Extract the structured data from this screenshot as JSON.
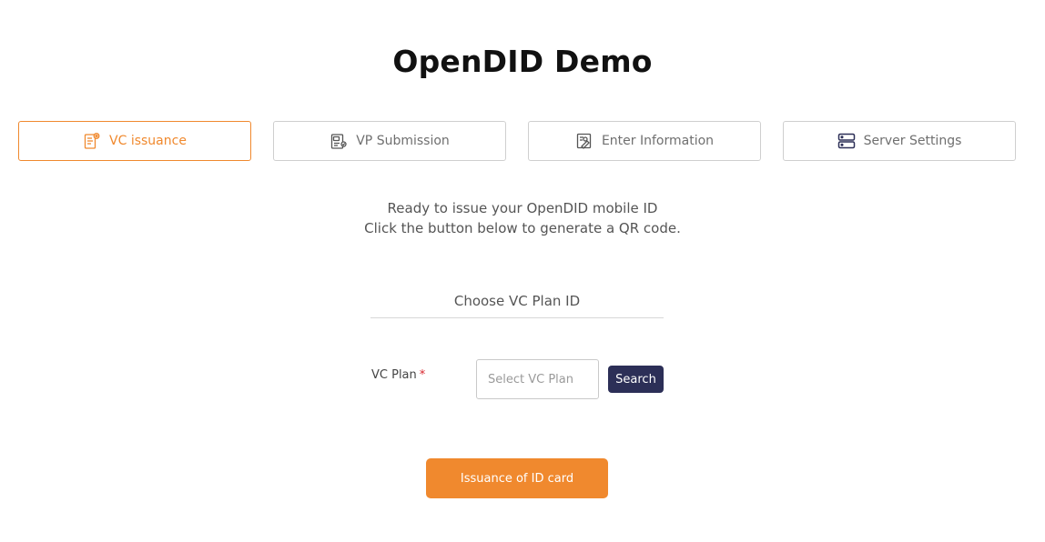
{
  "header": {
    "title": "OpenDID Demo"
  },
  "tabs": [
    {
      "label": "VC issuance",
      "icon": "vc-document-icon",
      "active": true
    },
    {
      "label": "VP Submission",
      "icon": "vp-document-icon",
      "active": false
    },
    {
      "label": "Enter Information",
      "icon": "edit-form-icon",
      "active": false
    },
    {
      "label": "Server Settings",
      "icon": "server-icon",
      "active": false
    }
  ],
  "intro": {
    "line1": "Ready to issue your OpenDID mobile ID",
    "line2": "Click the button below to generate a QR code."
  },
  "plan_section": {
    "title": "Choose VC Plan ID",
    "label": "VC Plan",
    "required_mark": "*",
    "input_placeholder": "Select VC Plan",
    "input_value": "",
    "search_label": "Search"
  },
  "actions": {
    "issue_label": "Issuance of ID card"
  },
  "colors": {
    "accent": "#f0892e",
    "navy": "#2c2f57",
    "required": "#d8262e"
  }
}
